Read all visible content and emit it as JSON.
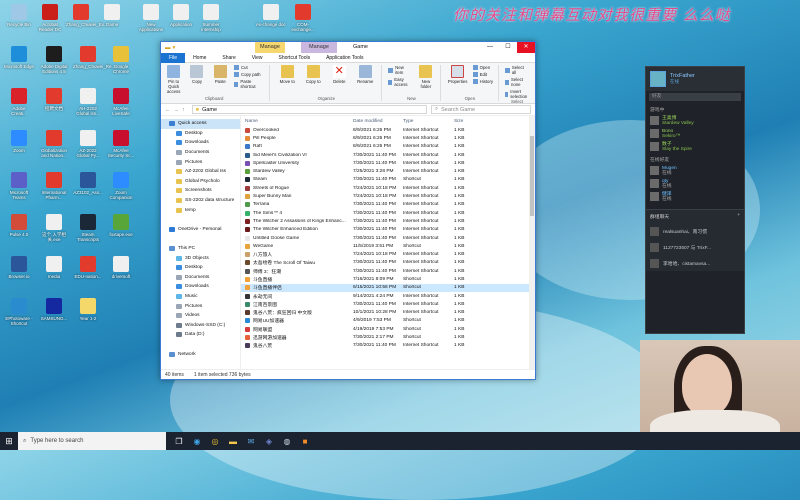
{
  "banner": "你的关注和弹幕互动对我很重要 么么哒",
  "desktop_icons": [
    {
      "label": "Recycle Bin",
      "color": "#9fc7e6"
    },
    {
      "label": "Acrobat Reader DC",
      "color": "#c91f18"
    },
    {
      "label": "Zhang_Chuwei_Ex...",
      "color": "#e23b2e"
    },
    {
      "label": "Game",
      "color": "#f0f0f0"
    },
    {
      "label": "New Applications",
      "color": "#f0f0f0"
    },
    {
      "label": "Application",
      "color": "#f0f0f0"
    },
    {
      "label": "Summer internship",
      "color": "#f0f0f0"
    },
    {
      "label": "ex-change doc",
      "color": "#f0f0f0"
    },
    {
      "label": "COM-exchange...",
      "color": "#e23b2e"
    },
    {
      "label": "Microsoft Edge",
      "color": "#1e8edb"
    },
    {
      "label": "Adobe Digital Editions 4.5",
      "color": "#1d1d1d"
    },
    {
      "label": "Zhang_Chuwei_Re...",
      "color": "#e23b2e"
    },
    {
      "label": "Google Chrome",
      "color": "#e8c13b"
    },
    {
      "label": "Adobe Creati...",
      "color": "#d9222a"
    },
    {
      "label": "招聘文档",
      "color": "#e23b2e"
    },
    {
      "label": "AH-2202 Global iss...",
      "color": "#f0f0f0"
    },
    {
      "label": "McAfee LiveSafe",
      "color": "#c8102e"
    },
    {
      "label": "Zoom",
      "color": "#2d8cff"
    },
    {
      "label": "Globalization and Nation...",
      "color": "#e23b2e"
    },
    {
      "label": "AZ-2022 Global Py...",
      "color": "#f0f0f0"
    },
    {
      "label": "McAfee Security Sc...",
      "color": "#c8102e"
    },
    {
      "label": "Microsoft Teams",
      "color": "#5b5fc7"
    },
    {
      "label": "International Pharm...",
      "color": "#e23b2e"
    },
    {
      "label": "AZ3102_Ass...",
      "color": "#2b579a"
    },
    {
      "label": "Zoom Companion",
      "color": "#2d8cff"
    },
    {
      "label": "Pulse 4.0",
      "color": "#d34c3a"
    },
    {
      "label": "这个.入学相关.exe",
      "color": "#f0f0f0"
    },
    {
      "label": "Steam Transcripts",
      "color": "#1b2838"
    },
    {
      "label": "foxtape.exe",
      "color": "#58a63a"
    },
    {
      "label": "Browser.io",
      "color": "#2b579a"
    },
    {
      "label": "media",
      "color": "#f0f0f0"
    },
    {
      "label": "EDU-nation...",
      "color": "#e23b2e"
    },
    {
      "label": "driversoft",
      "color": "#f0f0f0"
    },
    {
      "label": "EPhotoware - Shortcut",
      "color": "#2a8ccf"
    },
    {
      "label": "SAMSUNG...",
      "color": "#1428a0"
    },
    {
      "label": "Year 1-2",
      "color": "#f5d86a"
    }
  ],
  "taskbar": {
    "search_placeholder": "Type here to search",
    "icons": [
      "task-view",
      "edge",
      "chrome",
      "explorer",
      "mail",
      "discord",
      "steam",
      "app-orange"
    ]
  },
  "explorer": {
    "title": "Game",
    "manage1": "Manage",
    "manage2": "Manage",
    "tabs": [
      "File",
      "Home",
      "Share",
      "View",
      "Shortcut Tools",
      "Application Tools"
    ],
    "ribbon": {
      "pin": "Pin to Quick access",
      "copy": "Copy",
      "paste": "Paste",
      "cut": "Cut",
      "copy_path": "Copy path",
      "paste_shortcut": "Paste shortcut",
      "clipboard": "Clipboard",
      "move_to": "Move to",
      "copy_to": "Copy to",
      "delete": "Delete",
      "rename": "Rename",
      "organize": "Organize",
      "new_item": "New item",
      "easy_access": "Easy access",
      "new_folder": "New folder",
      "new": "New",
      "properties": "Properties",
      "open": "Open",
      "edit": "Edit",
      "history": "History",
      "open_group": "Open",
      "select_all": "Select all",
      "select_none": "Select none",
      "invert_selection": "Invert selection",
      "select": "Select"
    },
    "address_path": "Game",
    "search_placeholder": "Search Game",
    "nav": [
      {
        "label": "Quick access",
        "level": 1,
        "color": "#3b7ed1"
      },
      {
        "label": "Desktop",
        "level": 2,
        "color": "#3b8de0"
      },
      {
        "label": "Downloads",
        "level": 2,
        "color": "#3b8de0"
      },
      {
        "label": "Documents",
        "level": 2,
        "color": "#9aa6b5"
      },
      {
        "label": "Pictures",
        "level": 2,
        "color": "#9aa6b5"
      },
      {
        "label": "AZ-2202 Global Iss",
        "level": 2,
        "color": "#e9c34f"
      },
      {
        "label": "Global Psycholo",
        "level": 2,
        "color": "#e9c34f"
      },
      {
        "label": "Screenshots",
        "level": 2,
        "color": "#e9c34f"
      },
      {
        "label": "SS-2202 data structure",
        "level": 2,
        "color": "#e9c34f"
      },
      {
        "label": "temp",
        "level": 2,
        "color": "#e9c34f"
      },
      {
        "label": "",
        "level": 0,
        "color": ""
      },
      {
        "label": "OneDrive - Personal",
        "level": 1,
        "color": "#2b7bd6"
      },
      {
        "label": "",
        "level": 0,
        "color": ""
      },
      {
        "label": "This PC",
        "level": 1,
        "color": "#5a8fd0"
      },
      {
        "label": "3D Objects",
        "level": 2,
        "color": "#5db6e8"
      },
      {
        "label": "Desktop",
        "level": 2,
        "color": "#3b8de0"
      },
      {
        "label": "Documents",
        "level": 2,
        "color": "#9aa6b5"
      },
      {
        "label": "Downloads",
        "level": 2,
        "color": "#3b8de0"
      },
      {
        "label": "Music",
        "level": 2,
        "color": "#5db6e8"
      },
      {
        "label": "Pictures",
        "level": 2,
        "color": "#9aa6b5"
      },
      {
        "label": "Videos",
        "level": 2,
        "color": "#9aa6b5"
      },
      {
        "label": "Windows-SSD (C:)",
        "level": 2,
        "color": "#6c7c8c"
      },
      {
        "label": "Data (D:)",
        "level": 2,
        "color": "#6c7c8c"
      },
      {
        "label": "",
        "level": 0,
        "color": ""
      },
      {
        "label": "Network",
        "level": 1,
        "color": "#5a8fd0"
      }
    ],
    "columns": [
      "Name",
      "Date modified",
      "Type",
      "Size"
    ],
    "files": [
      {
        "name": "Overcooked",
        "date": "8/9/2021 6:26 PM",
        "type": "Internet Shortcut",
        "size": "1 KB",
        "color": "#c94a3a"
      },
      {
        "name": "Pill People",
        "date": "8/9/2021 6:26 PM",
        "type": "Internet Shortcut",
        "size": "1 KB",
        "color": "#e38b3a"
      },
      {
        "name": "Raft",
        "date": "8/9/2021 6:26 PM",
        "type": "Internet Shortcut",
        "size": "1 KB",
        "color": "#3a79c9"
      },
      {
        "name": "Sid Meier's Civilization VI",
        "date": "7/30/2021 11:40 PM",
        "type": "Internet Shortcut",
        "size": "1 KB",
        "color": "#2a5d8c"
      },
      {
        "name": "Spellcaster University",
        "date": "7/30/2021 11:40 PM",
        "type": "Internet Shortcut",
        "size": "1 KB",
        "color": "#7a4fb3"
      },
      {
        "name": "Stardew Valley",
        "date": "7/25/2021 3:28 PM",
        "type": "Internet Shortcut",
        "size": "1 KB",
        "color": "#5aa03a"
      },
      {
        "name": "Steam",
        "date": "7/30/2021 11:40 PM",
        "type": "Shortcut",
        "size": "1 KB",
        "color": "#1b2838"
      },
      {
        "name": "Streets of Rogue",
        "date": "7/24/2021 10:18 PM",
        "type": "Internet Shortcut",
        "size": "1 KB",
        "color": "#9b3a3a"
      },
      {
        "name": "Super Bunny Man",
        "date": "7/24/2021 10:18 PM",
        "type": "Internet Shortcut",
        "size": "1 KB",
        "color": "#e0a03a"
      },
      {
        "name": "Terraria",
        "date": "7/30/2021 11:40 PM",
        "type": "Internet Shortcut",
        "size": "1 KB",
        "color": "#4f9a4a"
      },
      {
        "name": "The Sims™ 4",
        "date": "7/30/2021 11:40 PM",
        "type": "Internet Shortcut",
        "size": "1 KB",
        "color": "#37b06a"
      },
      {
        "name": "The Witcher 2 Assassins of Kings Enhanc...",
        "date": "7/30/2021 11:40 PM",
        "type": "Internet Shortcut",
        "size": "1 KB",
        "color": "#7b2020"
      },
      {
        "name": "The Witcher Enhanced Edition",
        "date": "7/30/2021 11:40 PM",
        "type": "Internet Shortcut",
        "size": "1 KB",
        "color": "#6a1a1a"
      },
      {
        "name": "Untitled Goose Game",
        "date": "7/30/2021 11:40 PM",
        "type": "Internet Shortcut",
        "size": "1 KB",
        "color": "#e8e8e8"
      },
      {
        "name": "WeGame",
        "date": "11/5/2019 3:51 PM",
        "type": "Shortcut",
        "size": "1 KB",
        "color": "#e8a33a"
      },
      {
        "name": "八方旅人",
        "date": "7/24/2021 10:18 PM",
        "type": "Internet Shortcut",
        "size": "1 KB",
        "color": "#caa06a"
      },
      {
        "name": "太吾绘卷 The Scroll Of Taiwu",
        "date": "7/30/2021 11:40 PM",
        "type": "Internet Shortcut",
        "size": "1 KB",
        "color": "#6a4a2a"
      },
      {
        "name": "师傅 3：狂潮",
        "date": "7/30/2021 11:40 PM",
        "type": "Internet Shortcut",
        "size": "1 KB",
        "color": "#555555"
      },
      {
        "name": "斗鱼直播",
        "date": "7/16/2021 8:09 PM",
        "type": "Shortcut",
        "size": "1 KB",
        "color": "#f2a03a"
      },
      {
        "name": "斗鱼直播伴侣",
        "date": "6/15/2021 10:56 PM",
        "type": "Shortcut",
        "size": "1 KB",
        "color": "#f2a03a"
      },
      {
        "name": "永劫无间",
        "date": "9/14/2021 4:24 PM",
        "type": "Internet Shortcut",
        "size": "1 KB",
        "color": "#333333"
      },
      {
        "name": "江南百景图",
        "date": "7/30/2021 11:40 PM",
        "type": "Internet Shortcut",
        "size": "1 KB",
        "color": "#3a8a6a"
      },
      {
        "name": "鬼谷八荒：疯狂回归 中文版",
        "date": "10/1/2021 10:28 PM",
        "type": "Internet Shortcut",
        "size": "1 KB",
        "color": "#5a3a2a"
      },
      {
        "name": "网易UU加速器",
        "date": "4/9/2019 7:53 PM",
        "type": "Shortcut",
        "size": "1 KB",
        "color": "#2a8ad6"
      },
      {
        "name": "网易联盟",
        "date": "4/19/2019 7:53 PM",
        "type": "Shortcut",
        "size": "1 KB",
        "color": "#d63a3a"
      },
      {
        "name": "迅游网游加速器",
        "date": "7/30/2021 2:17 PM",
        "type": "Shortcut",
        "size": "1 KB",
        "color": "#e8603a"
      },
      {
        "name": "鬼谷八荒",
        "date": "7/30/2021 11:40 PM",
        "type": "Internet Shortcut",
        "size": "1 KB",
        "color": "#4a3a5a"
      }
    ],
    "selected_index": 19,
    "status_items": "40 items",
    "status_selected": "1 item selected 736 bytes"
  },
  "steam": {
    "username": "TrixFather",
    "status": "在线",
    "search": "好友",
    "section_ingame": "游戏中",
    "friends_ingame": [
      {
        "name": "王奥博",
        "game": "Stardew Valley"
      },
      {
        "name": "Bono",
        "game": "Sekiro™"
      },
      {
        "name": "数子",
        "game": "Slay the Spire"
      }
    ],
    "section_online": "在线好友",
    "friends_online": [
      {
        "name": "Mugen",
        "status": "在线"
      },
      {
        "name": "qty",
        "status": "在线"
      },
      {
        "name": "健泽",
        "status": "在线"
      }
    ],
    "chat_header": "群组聊天",
    "chats": [
      {
        "name": "realsuanhai、南习惯"
      },
      {
        "name": "1127723507 与 TrixF..."
      },
      {
        "name": "李哈哈、cistamavsa..."
      }
    ]
  }
}
